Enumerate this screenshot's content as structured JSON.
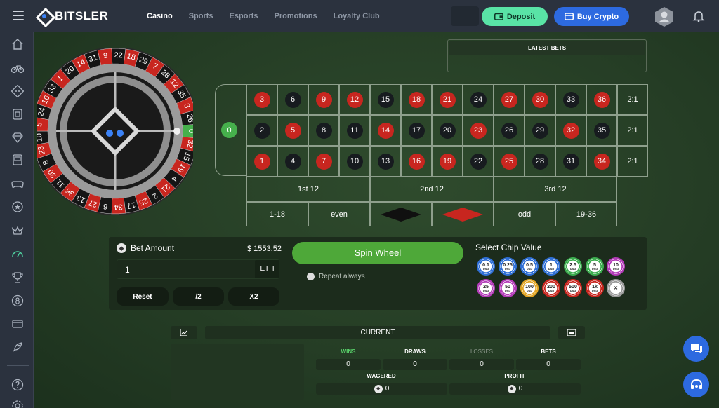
{
  "brand": {
    "name": "BITSLER"
  },
  "nav": {
    "items": [
      "Casino",
      "Sports",
      "Esports",
      "Promotions",
      "Loyalty Club"
    ],
    "active": "Casino"
  },
  "header": {
    "deposit_label": "Deposit",
    "buy_crypto_label": "Buy Crypto",
    "accent_green": "#59e3a6",
    "accent_blue": "#2d6ae0"
  },
  "sidebar": {
    "icons": [
      "home-icon",
      "bike-icon",
      "diamond-dots-icon",
      "dice-icon",
      "gem-icon",
      "slot-machine-icon",
      "gamepad-icon",
      "star-badge-icon",
      "crown-icon",
      "gauge-icon",
      "trophy-icon",
      "ball-eight-icon",
      "card-icon",
      "rocket-icon",
      "help-icon",
      "settings-icon"
    ],
    "active": "gauge-icon"
  },
  "latest_bets": {
    "title": "LATEST BETS"
  },
  "wheel": {
    "numbers": [
      "0",
      "32",
      "15",
      "19",
      "4",
      "21",
      "2",
      "25",
      "17",
      "34",
      "6",
      "27",
      "13",
      "36",
      "11",
      "30",
      "8",
      "23",
      "10",
      "5",
      "24",
      "16",
      "33",
      "1",
      "20",
      "14",
      "31",
      "9",
      "22",
      "18",
      "29",
      "7",
      "28",
      "12",
      "35",
      "3",
      "26"
    ]
  },
  "board": {
    "zero": "0",
    "rows": [
      [
        {
          "n": "3",
          "c": "red"
        },
        {
          "n": "6",
          "c": "black"
        },
        {
          "n": "9",
          "c": "red"
        },
        {
          "n": "12",
          "c": "red"
        },
        {
          "n": "15",
          "c": "black"
        },
        {
          "n": "18",
          "c": "red"
        },
        {
          "n": "21",
          "c": "red"
        },
        {
          "n": "24",
          "c": "black"
        },
        {
          "n": "27",
          "c": "red"
        },
        {
          "n": "30",
          "c": "red"
        },
        {
          "n": "33",
          "c": "black"
        },
        {
          "n": "36",
          "c": "red"
        }
      ],
      [
        {
          "n": "2",
          "c": "black"
        },
        {
          "n": "5",
          "c": "red"
        },
        {
          "n": "8",
          "c": "black"
        },
        {
          "n": "11",
          "c": "black"
        },
        {
          "n": "14",
          "c": "red"
        },
        {
          "n": "17",
          "c": "black"
        },
        {
          "n": "20",
          "c": "black"
        },
        {
          "n": "23",
          "c": "red"
        },
        {
          "n": "26",
          "c": "black"
        },
        {
          "n": "29",
          "c": "black"
        },
        {
          "n": "32",
          "c": "red"
        },
        {
          "n": "35",
          "c": "black"
        }
      ],
      [
        {
          "n": "1",
          "c": "red"
        },
        {
          "n": "4",
          "c": "black"
        },
        {
          "n": "7",
          "c": "red"
        },
        {
          "n": "10",
          "c": "black"
        },
        {
          "n": "13",
          "c": "black"
        },
        {
          "n": "16",
          "c": "red"
        },
        {
          "n": "19",
          "c": "red"
        },
        {
          "n": "22",
          "c": "black"
        },
        {
          "n": "25",
          "c": "red"
        },
        {
          "n": "28",
          "c": "black"
        },
        {
          "n": "31",
          "c": "black"
        },
        {
          "n": "34",
          "c": "red"
        }
      ]
    ],
    "column_bets": [
      "2:1",
      "2:1",
      "2:1"
    ],
    "dozens": [
      "1st 12",
      "2nd 12",
      "3rd 12"
    ],
    "outside": [
      "1-18",
      "even",
      "black-diamond",
      "red-diamond",
      "odd",
      "19-36"
    ]
  },
  "bet": {
    "amount_label": "Bet Amount",
    "balance": "$ 1553.52",
    "amount_value": "1",
    "currency": "ETH",
    "reset_label": "Reset",
    "half_label": "/2",
    "double_label": "X2",
    "spin_label": "Spin Wheel",
    "repeat_label": "Repeat always"
  },
  "chips": {
    "label": "Select Chip Value",
    "items": [
      {
        "v": "0.1",
        "u": "USD",
        "color": "#2f6fd6"
      },
      {
        "v": "0.25",
        "u": "USD",
        "color": "#2f6fd6"
      },
      {
        "v": "0.5",
        "u": "USD",
        "color": "#2f6fd6"
      },
      {
        "v": "1",
        "u": "USD",
        "color": "#2f6fd6"
      },
      {
        "v": "2.5",
        "u": "USD",
        "color": "#3cae4f"
      },
      {
        "v": "5",
        "u": "USD",
        "color": "#3cae4f"
      },
      {
        "v": "10",
        "u": "USD",
        "color": "#b33bb8"
      },
      {
        "v": "25",
        "u": "USD",
        "color": "#b33bb8"
      },
      {
        "v": "50",
        "u": "USD",
        "color": "#b33bb8"
      },
      {
        "v": "100",
        "u": "USD",
        "color": "#e2a524"
      },
      {
        "v": "200",
        "u": "USD",
        "color": "#c8261f"
      },
      {
        "v": "500",
        "u": "USD",
        "color": "#c8261f"
      },
      {
        "v": "1k",
        "u": "USD",
        "color": "#c8261f"
      },
      {
        "v": "✕",
        "u": "",
        "color": "#9a9a9a"
      }
    ]
  },
  "stats": {
    "current_label": "CURRENT",
    "wins_label": "WINS",
    "wins": "0",
    "draws_label": "DRAWS",
    "draws": "0",
    "losses_label": "LOSSES",
    "losses": "0",
    "bets_label": "BETS",
    "bets": "0",
    "wagered_label": "WAGERED",
    "wagered": "0",
    "profit_label": "PROFIT",
    "profit": "0"
  }
}
